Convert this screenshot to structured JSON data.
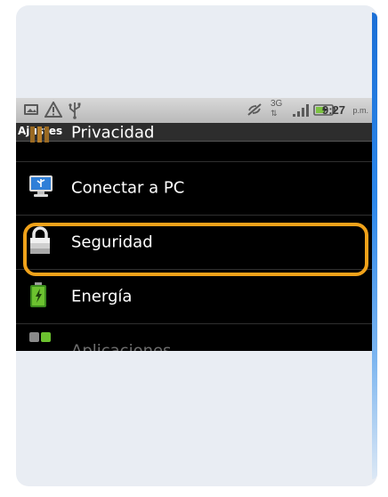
{
  "status_bar": {
    "time": "9:27",
    "ampm": "p.m.",
    "network": "3G",
    "left_icons": [
      "image-icon",
      "warning-icon",
      "usb-icon"
    ],
    "right_icons": [
      "no-sync-icon",
      "network-3g-icon",
      "signal-bars-icon",
      "battery-charging-icon"
    ]
  },
  "app": {
    "title": "Ajustes"
  },
  "settings_list": {
    "items": [
      {
        "label": "Privacidad",
        "icon": "privacy-icon"
      },
      {
        "label": "Conectar a PC",
        "icon": "pc-monitor-icon"
      },
      {
        "label": "Seguridad",
        "icon": "padlock-icon",
        "highlighted": true
      },
      {
        "label": "Energía",
        "icon": "battery-icon"
      },
      {
        "label": "Aplicaciones",
        "icon": "applications-icon"
      }
    ]
  },
  "colors": {
    "highlight": "#f0a21a",
    "card_background": "#e9edf3",
    "accent_edge": "#1b6fd6"
  }
}
